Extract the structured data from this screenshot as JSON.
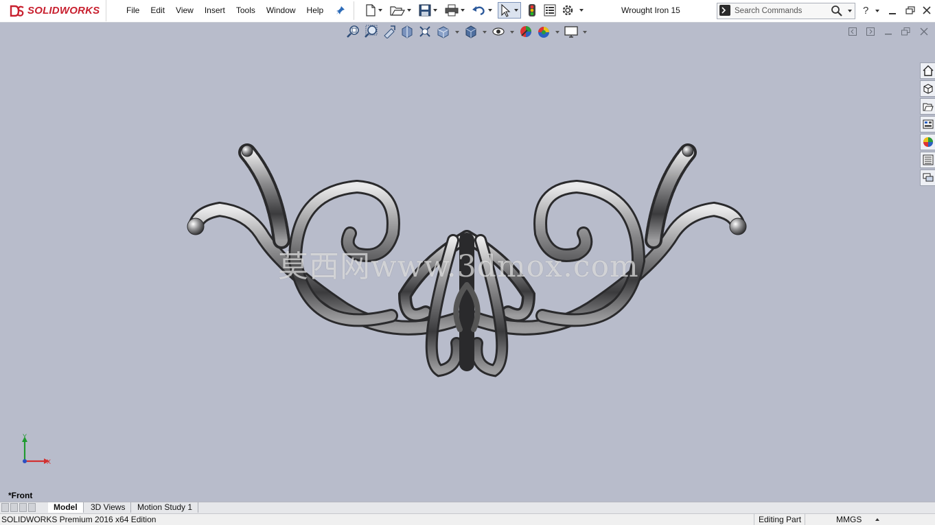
{
  "app": {
    "brand": "SOLIDWORKS",
    "document_title": "Wrought Iron 15"
  },
  "menu": [
    "File",
    "Edit",
    "View",
    "Insert",
    "Tools",
    "Window",
    "Help"
  ],
  "toolbar": {
    "icons": [
      "new-document-icon",
      "open-icon",
      "save-icon",
      "print-icon",
      "undo-icon",
      "select-icon",
      "rebuild-icon",
      "file-properties-icon",
      "options-icon"
    ]
  },
  "search": {
    "placeholder": "Search Commands"
  },
  "heads_up_toolbar": {
    "icons": [
      "zoom-to-fit-icon",
      "zoom-to-area-icon",
      "previous-view-icon",
      "section-view-icon",
      "view-orientation-icon",
      "display-style-icon",
      "hide-show-items-icon",
      "edit-appearance-icon",
      "apply-scene-icon",
      "view-settings-icon"
    ]
  },
  "task_pane": {
    "icons": [
      "home-icon",
      "3d-content-central-icon",
      "design-library-icon",
      "file-explorer-icon",
      "appearances-icon",
      "custom-properties-icon",
      "forum-icon"
    ]
  },
  "graphics": {
    "watermark": "莫西网www.3dmox.com",
    "view_label": "*Front",
    "triad": {
      "y": "Y",
      "x": "X"
    }
  },
  "tabs": [
    {
      "label": "Model",
      "active": true
    },
    {
      "label": "3D Views",
      "active": false
    },
    {
      "label": "Motion Study 1",
      "active": false
    }
  ],
  "status": {
    "version": "SOLIDWORKS Premium 2016 x64 Edition",
    "mode": "Editing Part",
    "units": "MMGS"
  },
  "colors": {
    "viewport_background": "#b8bccb",
    "brand_red": "#c8202f"
  }
}
